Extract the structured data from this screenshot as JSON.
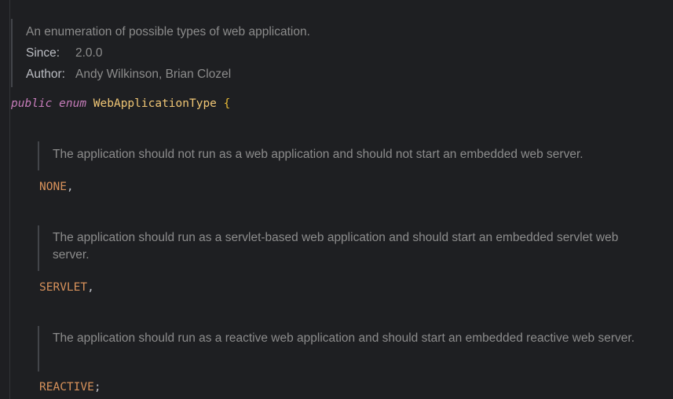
{
  "enum_doc": {
    "description": "An enumeration of possible types of web application.",
    "since_label": "Since:",
    "since_value": "2.0.0",
    "author_label": "Author:",
    "author_value": "Andy Wilkinson, Brian Clozel"
  },
  "declaration": {
    "modifier": "public",
    "keyword": "enum",
    "name": "WebApplicationType",
    "open_brace": "{"
  },
  "constants": [
    {
      "doc": "The application should not run as a web application and should not start an embedded web server.",
      "name": "NONE",
      "terminator": ","
    },
    {
      "doc": "The application should run as a servlet-based web application and should start an embedded servlet web server.",
      "name": "SERVLET",
      "terminator": ","
    },
    {
      "doc": "The application should run as a reactive web application and should start an embedded reactive web server.",
      "name": "REACTIVE",
      "terminator": ";"
    }
  ],
  "colors": {
    "background": "#1e1f22",
    "keyword": "#c77dbb",
    "class_name": "#f0c675",
    "constant": "#d8925b",
    "doc_text": "#8c8c8c"
  }
}
